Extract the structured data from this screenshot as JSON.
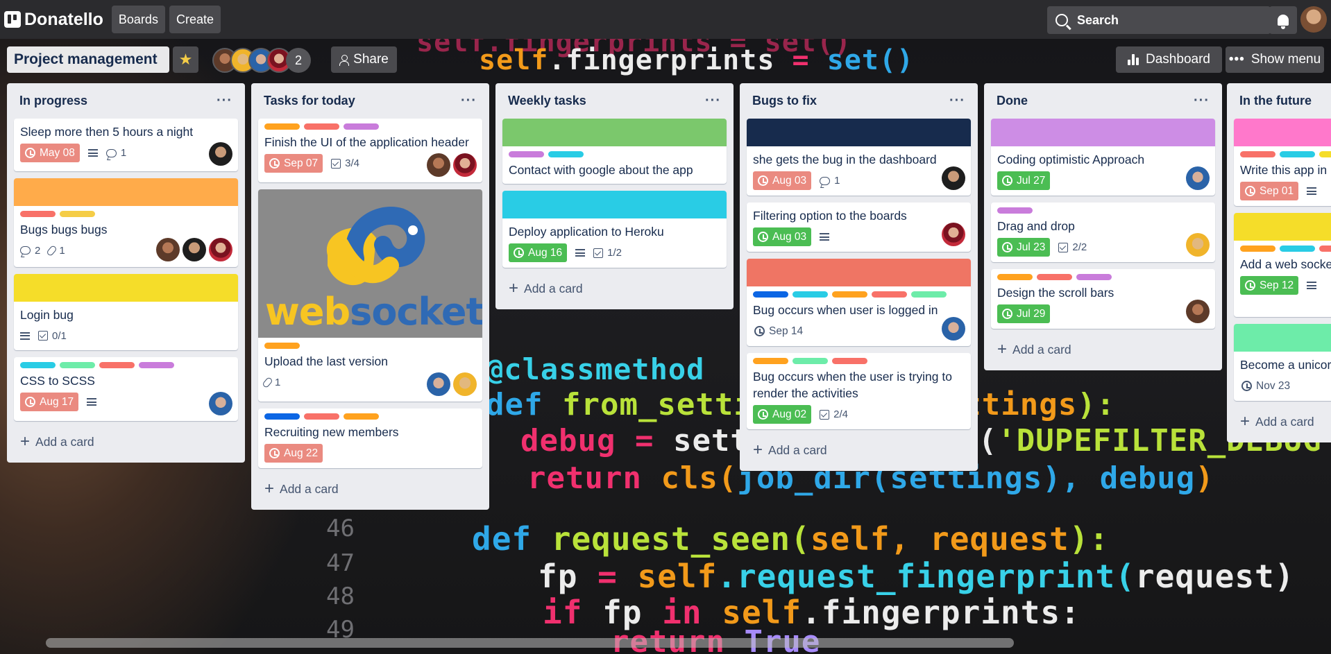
{
  "app": {
    "name": "Donatello",
    "nav": {
      "boards": "Boards",
      "create": "Create"
    },
    "search_label": "Search",
    "icons": {
      "logo": "board-logo-icon",
      "search": "search-icon",
      "bell": "bell-icon"
    }
  },
  "board": {
    "title": "Project management",
    "member_extra_count": "2",
    "share": "Share",
    "dashboard": "Dashboard",
    "show_menu": "Show menu"
  },
  "lists": [
    {
      "title": "In progress",
      "add_card": "Add a card",
      "cards": [
        {
          "title": "Sleep more then 5 hours a night",
          "due": "May 08",
          "due_status": "overdue",
          "description": true,
          "comments": "1"
        },
        {
          "cover": "#ffab4a",
          "labels": [
            "#f87168",
            "#f5cd47"
          ],
          "title": "Bugs bugs bugs",
          "comments": "2",
          "attachments": "1"
        },
        {
          "cover": "#f5dd29",
          "title": "Login bug",
          "description": true,
          "checklist": "0/1"
        },
        {
          "labels": [
            "#29cce5",
            "#6deca9",
            "#f87168",
            "#c97cdb"
          ],
          "title": "CSS to SCSS",
          "due": "Aug 17",
          "due_status": "overdue",
          "description": true
        }
      ]
    },
    {
      "title": "Tasks for today",
      "add_card": "Add a card",
      "cards": [
        {
          "labels": [
            "#ffa21f",
            "#f87168",
            "#c97cdb"
          ],
          "title": "Finish the UI of the application header",
          "due": "Sep 07",
          "due_status": "overdue",
          "checklist": "3/4"
        },
        {
          "image": {
            "word_1": "web",
            "word_2": "sockets"
          },
          "labels": [
            "#ffa21f"
          ],
          "title": "Upload the last version",
          "attachments": "1"
        },
        {
          "labels": [
            "#0c66e4",
            "#f87168",
            "#ffa21f"
          ],
          "title": "Recruiting new members",
          "due": "Aug 22",
          "due_status": "overdue"
        }
      ]
    },
    {
      "title": "Weekly tasks",
      "add_card": "Add a card",
      "cards": [
        {
          "cover": "#7bc86c",
          "labels": [
            "#c97cdb",
            "#29cce5"
          ],
          "title": "Contact with google about the app"
        },
        {
          "cover": "#29cce5",
          "title": "Deploy application to Heroku",
          "due": "Aug 16",
          "due_status": "done",
          "description": true,
          "checklist": "1/2"
        }
      ]
    },
    {
      "title": "Bugs to fix",
      "add_card": "Add a card",
      "cards": [
        {
          "cover": "#172b4d",
          "title": "she gets the bug in the dashboard",
          "due": "Aug 03",
          "due_status": "overdue",
          "comments": "1"
        },
        {
          "title": "Filtering option to the boards",
          "due": "Aug 03",
          "due_status": "done",
          "description": true
        },
        {
          "cover": "#ef7564",
          "labels": [
            "#0c66e4",
            "#29cce5",
            "#ffa21f",
            "#f87168",
            "#6deca9"
          ],
          "title": "Bug occurs when user is logged in",
          "due": "Sep 14",
          "due_status": "none"
        },
        {
          "labels": [
            "#ffa21f",
            "#6deca9",
            "#f87168"
          ],
          "title": "Bug occurs when the user is trying to render the activities",
          "due": "Aug 02",
          "due_status": "done",
          "checklist": "2/4"
        }
      ]
    },
    {
      "title": "Done",
      "add_card": "Add a card",
      "cards": [
        {
          "cover": "#cd8de5",
          "title": "Coding optimistic Approach",
          "due": "Jul 27",
          "due_status": "done"
        },
        {
          "labels": [
            "#c97cdb"
          ],
          "title": "Drag and drop",
          "due": "Jul 23",
          "due_status": "done",
          "checklist": "2/2"
        },
        {
          "labels": [
            "#ffa21f",
            "#f87168",
            "#c97cdb"
          ],
          "title": "Design the scroll bars",
          "due": "Jul 29",
          "due_status": "done"
        }
      ]
    },
    {
      "title": "In the future",
      "add_card": "Add a card",
      "cards": [
        {
          "cover": "#ff78cb",
          "labels": [
            "#f87168",
            "#29cce5",
            "#f5dd29"
          ],
          "title": "Write this app in",
          "due": "Sep 01",
          "due_status": "overdue"
        },
        {
          "cover": "#f5dd29",
          "labels": [
            "#ffa21f",
            "#29cce5",
            "#f87168"
          ],
          "title": "Add a web socke",
          "due": "Sep 12",
          "due_status": "done"
        },
        {
          "cover": "#6deca9",
          "title": "Become a unicor",
          "due": "Nov 23",
          "due_status": "none"
        }
      ]
    }
  ],
  "background_code": {
    "lines": [
      "self.fingerprints = set()",
      "@classmethod",
      "def from_settings(cls, settings):",
      "debug = settings.getbool('DUPEFILTER_DEBUG')",
      "return cls(job_dir(settings), debug)",
      "def request_seen(self, request):",
      "fp = self.request_fingerprint(request)",
      "if fp in self.fingerprints:",
      "return True"
    ],
    "line_numbers": [
      "46",
      "47",
      "48",
      "49"
    ]
  }
}
